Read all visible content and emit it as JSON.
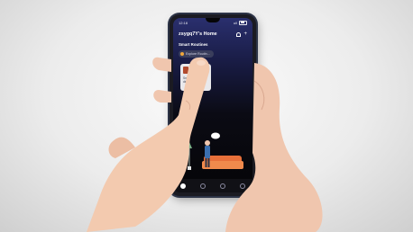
{
  "status_bar": {
    "time": "12:18",
    "signal": "ull",
    "wifi": "wifi-icon",
    "battery_icon": "battery-icon"
  },
  "header": {
    "home_name": "zsygq7Y's Home",
    "add_icon": "plus-icon",
    "notification_icon": "bell-icon"
  },
  "section": {
    "title": "Smart Routines"
  },
  "routine": {
    "label": "Explore Routin..."
  },
  "device_card": {
    "name_line1": "Smart",
    "name_line2": "dimm..."
  },
  "tabs": [
    {
      "icon": "home-icon",
      "active": true
    },
    {
      "icon": "explore-icon",
      "active": false
    },
    {
      "icon": "scene-icon",
      "active": false
    },
    {
      "icon": "profile-icon",
      "active": false
    }
  ],
  "colors": {
    "screen_top": "#2a2f6e",
    "screen_bottom": "#050507",
    "sofa": "#e8703a",
    "skin": "#f0c6ae"
  }
}
